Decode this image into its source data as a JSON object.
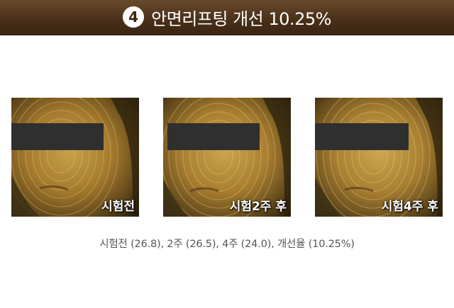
{
  "header": {
    "step_number": "4",
    "title": "안면리프팅 개선 10.25%",
    "accent": "#4a3019"
  },
  "photos": [
    {
      "label": "시험전"
    },
    {
      "label": "시험2주 후"
    },
    {
      "label": "시험4주 후"
    }
  ],
  "caption": "시험전 (26.8), 2주 (26.5), 4주 (24.0), 개선율 (10.25%)"
}
